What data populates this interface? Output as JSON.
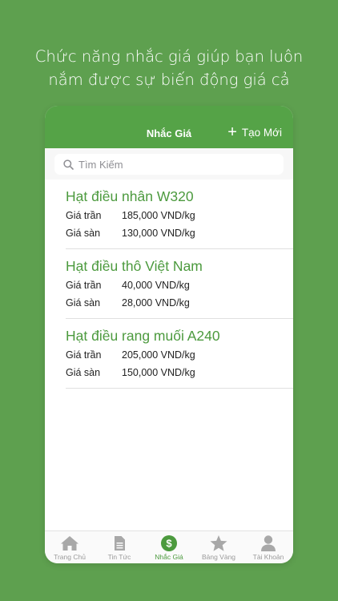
{
  "headline": {
    "line1": "Chức năng nhắc giá giúp bạn luôn",
    "line2": "nắm được sự biến động giá cả"
  },
  "navbar": {
    "title": "Nhắc Giá",
    "action_label": "Tạo Mới",
    "action_icon": "plus-icon"
  },
  "search": {
    "placeholder": "Tìm Kiếm",
    "icon": "search-icon"
  },
  "alerts": [
    {
      "name": "Hạt điều nhân W320",
      "ceiling_label": "Giá trần",
      "ceiling": "185,000 VND/kg",
      "floor_label": "Giá sàn",
      "floor": "130,000 VND/kg"
    },
    {
      "name": "Hạt điều thô Việt Nam",
      "ceiling_label": "Giá trần",
      "ceiling": "40,000 VND/kg",
      "floor_label": "Giá sàn",
      "floor": "28,000 VND/kg"
    },
    {
      "name": "Hạt điều rang muối A240",
      "ceiling_label": "Giá trần",
      "ceiling": "205,000 VND/kg",
      "floor_label": "Giá sàn",
      "floor": "150,000 VND/kg"
    }
  ],
  "tabs": [
    {
      "label": "Trang Chủ",
      "icon": "home-icon"
    },
    {
      "label": "Tin Tức",
      "icon": "document-icon"
    },
    {
      "label": "Nhắc Giá",
      "icon": "dollar-icon",
      "active": true
    },
    {
      "label": "Bảng Vàng",
      "icon": "star-icon"
    },
    {
      "label": "Tài Khoản",
      "icon": "person-icon"
    }
  ],
  "colors": {
    "background": "#5ea04f",
    "accent": "#55a347",
    "inactive": "#9a9a9a"
  }
}
